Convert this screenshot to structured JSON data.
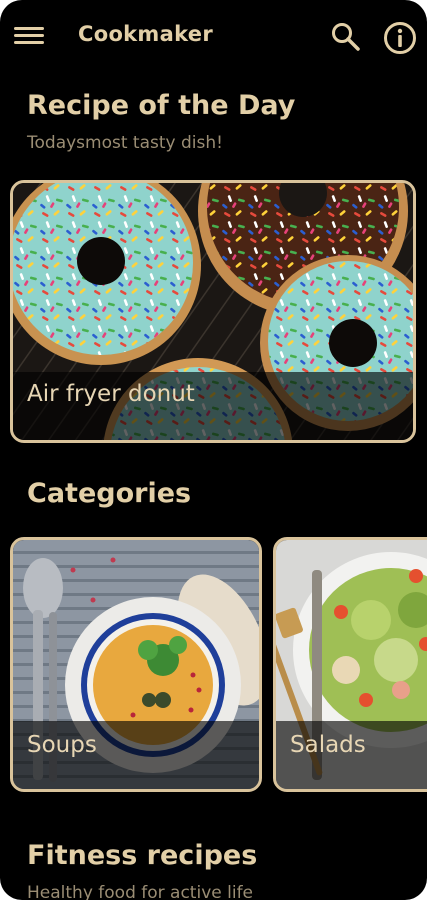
{
  "appbar": {
    "title": "Cookmaker",
    "menu_icon": "hamburger-menu-icon",
    "search_icon": "search-icon",
    "info_icon": "info-icon"
  },
  "recipe_of_day": {
    "title": "Recipe of the Day",
    "subtitle": "Todaysmost tasty dish!",
    "recipe_name": "Air fryer donut"
  },
  "categories": {
    "title": "Categories",
    "items": [
      {
        "label": "Soups"
      },
      {
        "label": "Salads"
      }
    ]
  },
  "fitness": {
    "title": "Fitness recipes",
    "subtitle": "Healthy food for active life"
  },
  "colors": {
    "background": "#000000",
    "accent": "#e2cfa7",
    "card_border": "#d9c39b",
    "subtitle": "#9a8d74"
  }
}
